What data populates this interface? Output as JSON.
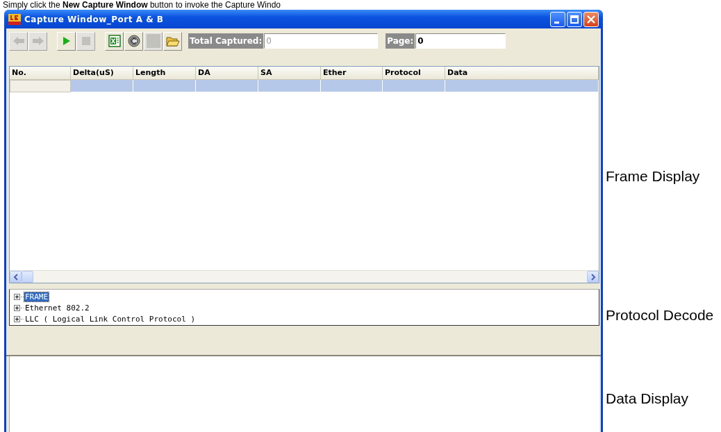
{
  "document_text": "Simply click the **New Capture Window** button to invoke the Capture Windo",
  "window": {
    "title": "Capture Window_Port A & B"
  },
  "toolbar": {
    "buttons": [
      {
        "kind": "back",
        "disabled": true
      },
      {
        "kind": "forward",
        "disabled": true
      },
      {
        "kind": "play",
        "disabled": false
      },
      {
        "kind": "stop",
        "disabled": true
      },
      {
        "kind": "excel",
        "disabled": false
      },
      {
        "kind": "circle",
        "disabled": false
      },
      {
        "kind": "blank",
        "disabled": true
      },
      {
        "kind": "folder",
        "disabled": false
      }
    ],
    "total_captured": {
      "label": "Total Captured:",
      "value": "0"
    },
    "page": {
      "label": "Page:",
      "value": "0"
    }
  },
  "table": {
    "columns": [
      "No.",
      "Delta(uS)",
      "Length",
      "DA",
      "SA",
      "Ether",
      "Protocol",
      "Data"
    ],
    "rows": [
      {
        "selected": true
      }
    ]
  },
  "tree": {
    "items": [
      {
        "label": "FRAME",
        "selected": true,
        "expanded": false
      },
      {
        "label": "Ethernet 802.2",
        "selected": false,
        "expanded": false
      },
      {
        "label": "LLC ( Logical Link Control Protocol )",
        "selected": false,
        "expanded": false
      }
    ]
  },
  "annotations": [
    "Frame Display",
    "Protocol Decode",
    "Data Display"
  ]
}
